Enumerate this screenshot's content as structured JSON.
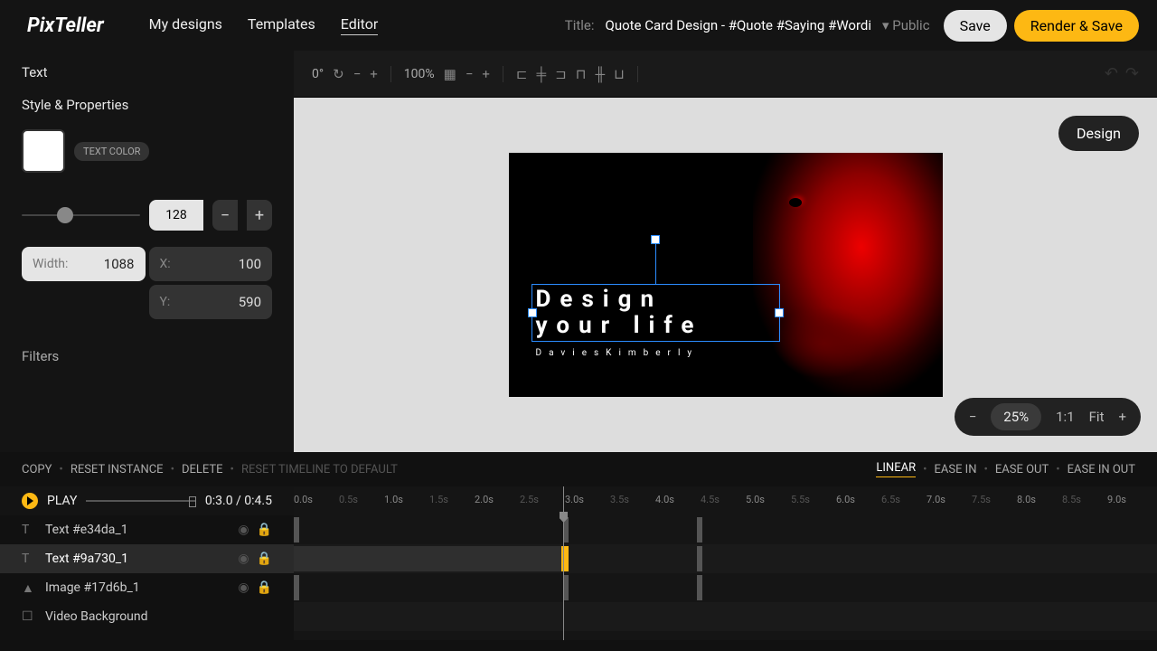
{
  "logo": "PixTeller",
  "nav": {
    "designs": "My designs",
    "templates": "Templates",
    "editor": "Editor"
  },
  "title": {
    "label": "Title:",
    "text": "Quote Card Design - #Quote #Saying #Wordi",
    "visibility": "Public"
  },
  "buttons": {
    "save": "Save",
    "render": "Render & Save",
    "mode": "Design"
  },
  "sidebar": {
    "text_heading": "Text",
    "style_heading": "Style & Properties",
    "text_color_label": "TEXT COLOR",
    "fontsize": "128",
    "width_label": "Width:",
    "width": "1088",
    "x_label": "X:",
    "x": "100",
    "y_label": "Y:",
    "y": "590",
    "filters": "Filters"
  },
  "toolbar": {
    "rotate": "0°",
    "opacity": "100%"
  },
  "canvas": {
    "line1": "Design",
    "line2": "your life",
    "sub": "DaviesKimberly"
  },
  "zoom": {
    "value": "25%",
    "ratio": "1:1",
    "fit": "Fit"
  },
  "tl_actions": {
    "copy": "COPY",
    "reset": "RESET INSTANCE",
    "delete": "DELETE",
    "reset_tl": "RESET TIMELINE TO DEFAULT"
  },
  "easing": {
    "linear": "LINEAR",
    "easein": "EASE IN",
    "easeout": "EASE OUT",
    "easeinout": "EASE IN OUT"
  },
  "play": {
    "label": "PLAY",
    "time": "0:3.0 / 0:4.5"
  },
  "layers": {
    "l1": "Text #e34da_1",
    "l2": "Text #9a730_1",
    "l3": "Image #17d6b_1",
    "l4": "Video Background"
  },
  "ruler": [
    "0.0s",
    "0.5s",
    "1.0s",
    "1.5s",
    "2.0s",
    "2.5s",
    "3.0s",
    "3.5s",
    "4.0s",
    "4.5s",
    "5.0s",
    "5.5s",
    "6.0s",
    "6.5s",
    "7.0s",
    "7.5s",
    "8.0s",
    "8.5s",
    "9.0s"
  ]
}
